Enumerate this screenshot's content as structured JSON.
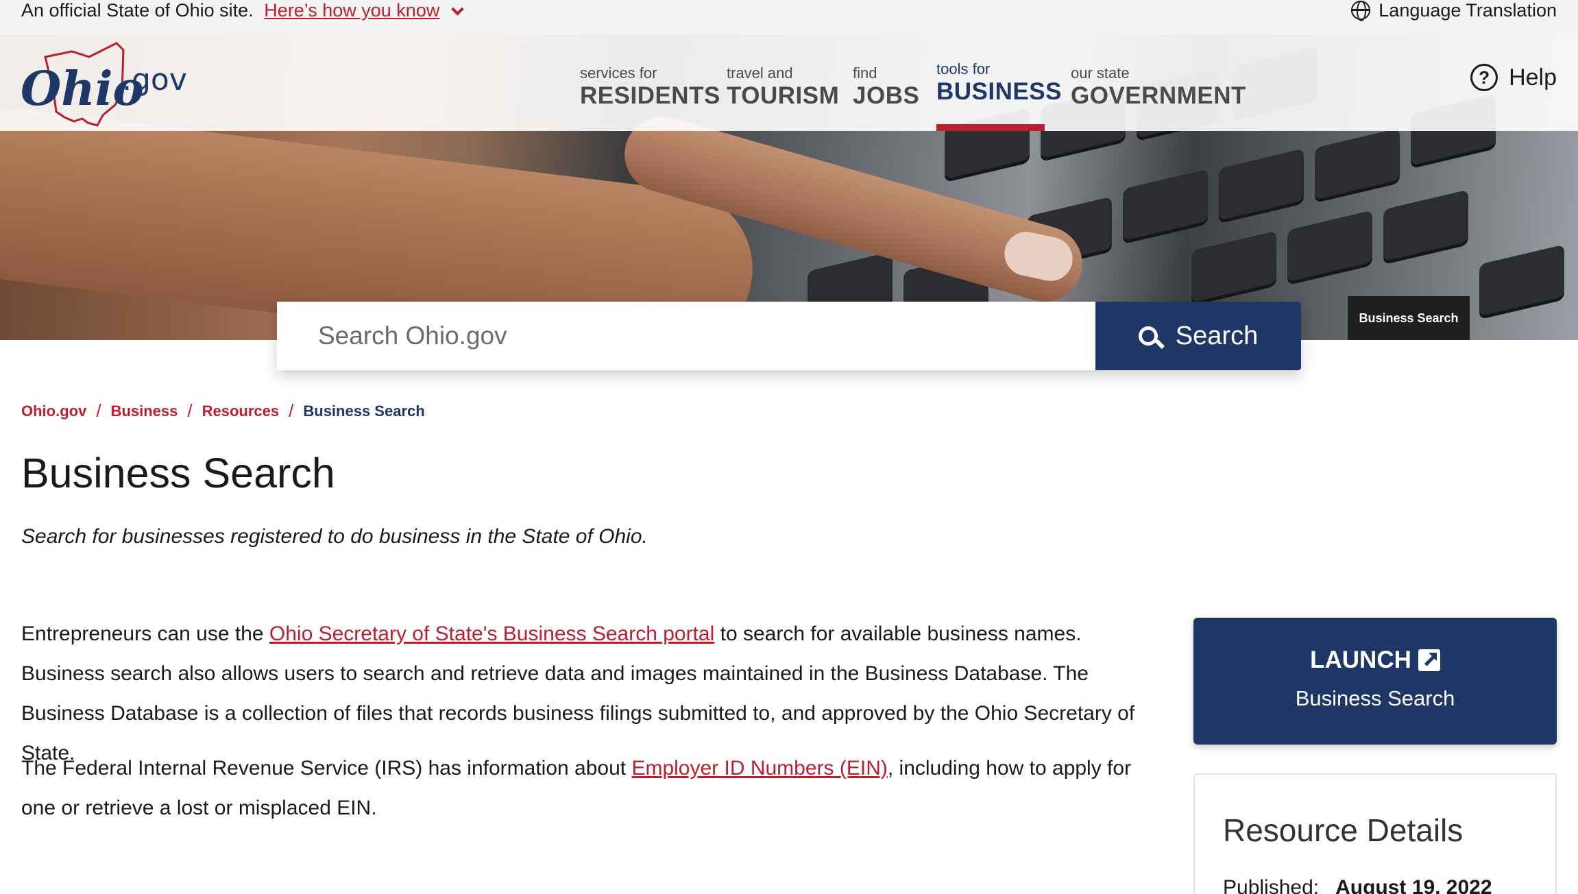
{
  "banner": {
    "official_text": "An official State of Ohio site.",
    "how_link": "Here’s how you know",
    "language": "Language Translation"
  },
  "header": {
    "logo_text": "Ohio",
    "logo_suffix": ".gov",
    "nav": [
      {
        "small": "services for",
        "big": "RESIDENTS"
      },
      {
        "small": "travel and",
        "big": "TOURISM"
      },
      {
        "small": "find",
        "big": "JOBS"
      },
      {
        "small": "tools for",
        "big": "BUSINESS"
      },
      {
        "small": "our state",
        "big": "GOVERNMENT"
      }
    ],
    "help": "Help"
  },
  "hero": {
    "image_caption": "Business Search"
  },
  "search": {
    "placeholder": "Search Ohio.gov",
    "button": "Search"
  },
  "breadcrumb": [
    "Ohio.gov",
    "Business",
    "Resources",
    "Business Search"
  ],
  "page": {
    "title": "Business Search",
    "subtitle": "Search for businesses registered to do business in the State of Ohio.",
    "p1_before": "Entrepreneurs can use the ",
    "p1_link": "Ohio Secretary of State's Business Search portal",
    "p1_after": " to search for available business names. Business search also allows users to search and retrieve data and images maintained in the Business Database. The Business Database is a collection of files that records business filings submitted to, and approved by the Ohio Secretary of State.",
    "p2_before": "The Federal Internal Revenue Service (IRS) has information about ",
    "p2_link": "Employer ID Numbers (EIN)",
    "p2_after": ", including how to apply for one or retrieve a lost or misplaced EIN."
  },
  "launch": {
    "label": "LAUNCH",
    "target": "Business Search"
  },
  "resource": {
    "title": "Resource Details",
    "published_label": "Published:",
    "published_value": "August 19, 2022"
  },
  "colors": {
    "brand_blue": "#1e3766",
    "brand_red": "#bb1f2d"
  }
}
